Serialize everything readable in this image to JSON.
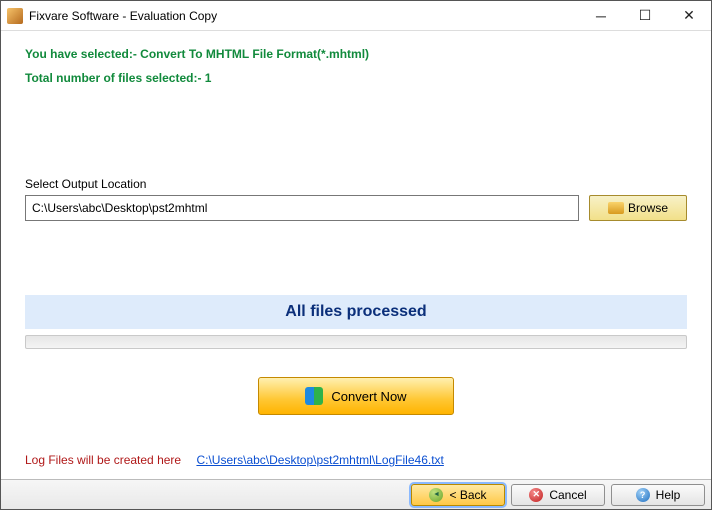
{
  "window": {
    "title": "Fixvare Software - Evaluation Copy"
  },
  "status": {
    "selected_format": "You have selected:- Convert To MHTML File Format(*.mhtml)",
    "file_count": "Total number of files selected:- 1"
  },
  "output": {
    "label": "Select Output Location",
    "path": "C:\\Users\\abc\\Desktop\\pst2mhtml",
    "browse_label": "Browse"
  },
  "progress": {
    "message": "All files processed"
  },
  "actions": {
    "convert_label": "Convert Now"
  },
  "log": {
    "label": "Log Files will be created here",
    "link_text": "C:\\Users\\abc\\Desktop\\pst2mhtml\\LogFile46.txt"
  },
  "footer": {
    "back": "< Back",
    "cancel": "Cancel",
    "help": "Help"
  }
}
